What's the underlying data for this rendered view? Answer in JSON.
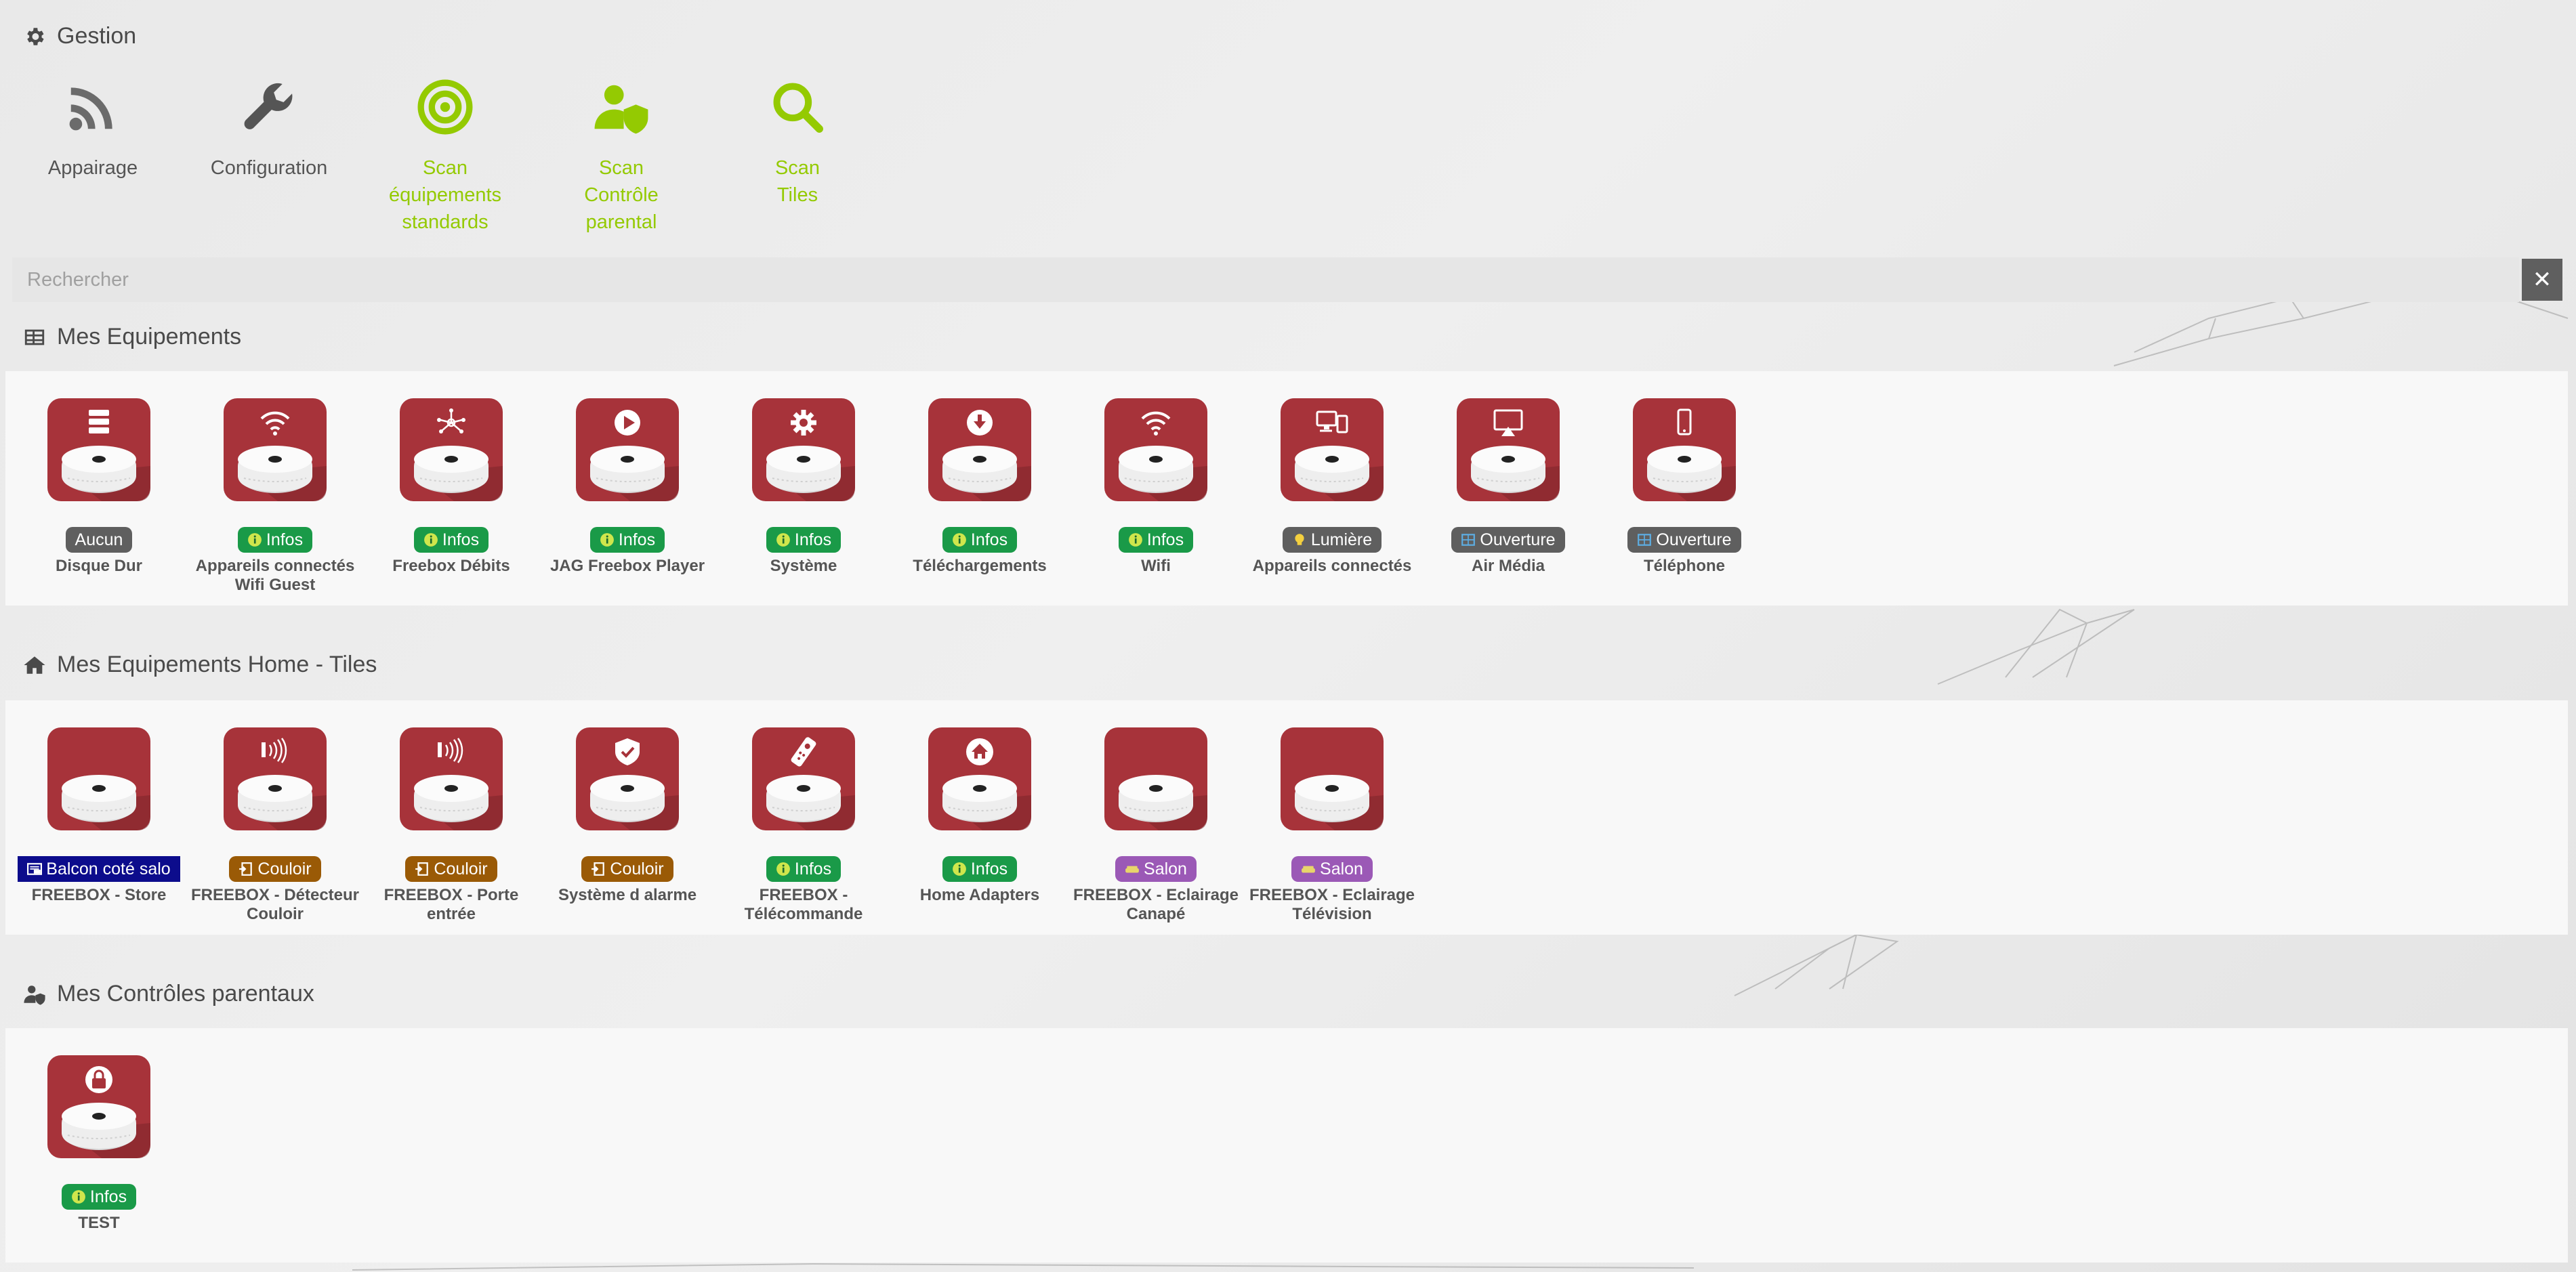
{
  "gestion": {
    "title": "Gestion",
    "items": [
      {
        "label": "Appairage",
        "icon": "rss-icon",
        "color": "#555555"
      },
      {
        "label": "Configuration",
        "icon": "wrench-icon",
        "color": "#555555"
      },
      {
        "label": "Scan\néquipements\nstandards",
        "icon": "target-icon",
        "color": "#94ca02"
      },
      {
        "label": "Scan\nContrôle parental",
        "icon": "user-shield-icon",
        "color": "#94ca02"
      },
      {
        "label": "Scan\nTiles",
        "icon": "search-icon",
        "color": "#94ca02"
      }
    ]
  },
  "search": {
    "placeholder": "Rechercher",
    "clear_icon": "close-icon"
  },
  "mes_equipements": {
    "title": "Mes Equipements",
    "items": [
      {
        "name": "Disque Dur",
        "badge": "Aucun",
        "badge_color": "#5f5f5f",
        "badge_icon": "",
        "glyph": "server-icon"
      },
      {
        "name": "Appareils connectés\nWifi Guest",
        "badge": "Infos",
        "badge_color": "#1a9a48",
        "badge_icon": "info-icon",
        "glyph": "wifi-icon"
      },
      {
        "name": "Freebox Débits",
        "badge": "Infos",
        "badge_color": "#1a9a48",
        "badge_icon": "info-icon",
        "glyph": "network-icon"
      },
      {
        "name": "JAG Freebox Player",
        "badge": "Infos",
        "badge_color": "#1a9a48",
        "badge_icon": "info-icon",
        "glyph": "play-icon"
      },
      {
        "name": "Système",
        "badge": "Infos",
        "badge_color": "#1a9a48",
        "badge_icon": "info-icon",
        "glyph": "gear-icon"
      },
      {
        "name": "Téléchargements",
        "badge": "Infos",
        "badge_color": "#1a9a48",
        "badge_icon": "info-icon",
        "glyph": "download-icon"
      },
      {
        "name": "Wifi",
        "badge": "Infos",
        "badge_color": "#1a9a48",
        "badge_icon": "info-icon",
        "glyph": "wifi-icon"
      },
      {
        "name": "Appareils connectés",
        "badge": "Lumière",
        "badge_color": "#5f5f5f",
        "badge_icon": "bulb-icon",
        "glyph": "devices-icon"
      },
      {
        "name": "Air Média",
        "badge": "Ouverture",
        "badge_color": "#5f5f5f",
        "badge_icon": "window-icon",
        "glyph": "airplay-icon"
      },
      {
        "name": "Téléphone",
        "badge": "Ouverture",
        "badge_color": "#5f5f5f",
        "badge_icon": "window-icon",
        "glyph": "phone-icon"
      }
    ]
  },
  "mes_tiles": {
    "title": "Mes Equipements Home - Tiles",
    "items": [
      {
        "name": "FREEBOX - Store",
        "badge": "Balcon coté salo",
        "badge_color": "#0c0c8c",
        "badge_icon": "garage-icon",
        "glyph": ""
      },
      {
        "name": "FREEBOX - Détecteur\nCouloir",
        "badge": "Couloir",
        "badge_color": "#9a5a06",
        "badge_icon": "door-icon",
        "glyph": "motion-icon"
      },
      {
        "name": "FREEBOX - Porte\nentrée",
        "badge": "Couloir",
        "badge_color": "#9a5a06",
        "badge_icon": "door-icon",
        "glyph": "motion-icon"
      },
      {
        "name": "Système d alarme",
        "badge": "Couloir",
        "badge_color": "#9a5a06",
        "badge_icon": "door-icon",
        "glyph": "shield-check-icon"
      },
      {
        "name": "FREEBOX -\nTélécommande",
        "badge": "Infos",
        "badge_color": "#1a9a48",
        "badge_icon": "info-icon",
        "glyph": "remote-icon"
      },
      {
        "name": "Home Adapters",
        "badge": "Infos",
        "badge_color": "#1a9a48",
        "badge_icon": "info-icon",
        "glyph": "home-icon"
      },
      {
        "name": "FREEBOX - Eclairage\nCanapé",
        "badge": "Salon",
        "badge_color": "#9b59b6",
        "badge_icon": "sofa-icon",
        "glyph": ""
      },
      {
        "name": "FREEBOX - Eclairage\nTélévision",
        "badge": "Salon",
        "badge_color": "#9b59b6",
        "badge_icon": "sofa-icon",
        "glyph": ""
      }
    ]
  },
  "mes_controles": {
    "title": "Mes Contrôles parentaux",
    "items": [
      {
        "name": "TEST",
        "badge": "Infos",
        "badge_color": "#1a9a48",
        "badge_icon": "info-icon",
        "glyph": "lock-icon"
      }
    ]
  },
  "colors": {
    "accent_green": "#94ca02",
    "tile_red": "#a7333a",
    "tile_red_dark": "#7d242a"
  }
}
